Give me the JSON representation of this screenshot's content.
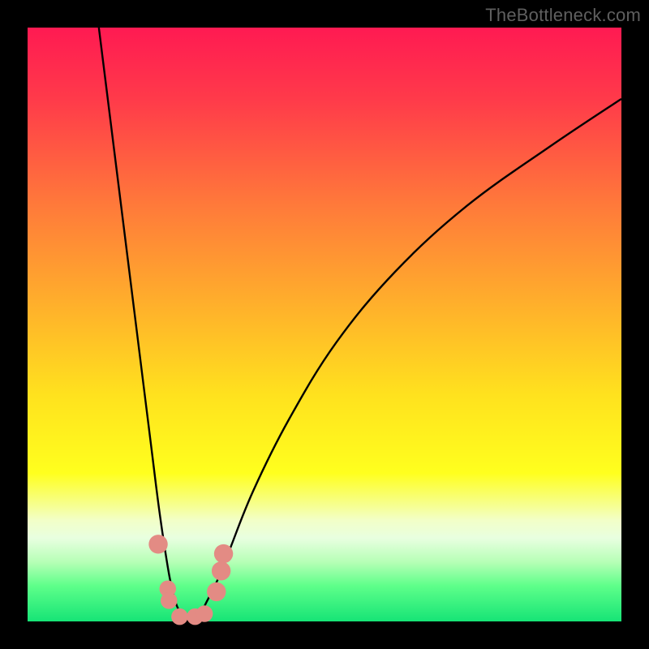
{
  "watermark": "TheBottleneck.com",
  "gradient": {
    "stops": [
      {
        "pct": 0,
        "color": "#ff1a52"
      },
      {
        "pct": 12,
        "color": "#ff3a4a"
      },
      {
        "pct": 30,
        "color": "#ff7a3a"
      },
      {
        "pct": 48,
        "color": "#ffb42a"
      },
      {
        "pct": 62,
        "color": "#ffe21e"
      },
      {
        "pct": 75,
        "color": "#ffff1e"
      },
      {
        "pct": 80,
        "color": "#f7ff87"
      },
      {
        "pct": 83,
        "color": "#f2ffc8"
      },
      {
        "pct": 86,
        "color": "#e8ffe0"
      },
      {
        "pct": 90,
        "color": "#b6ffb6"
      },
      {
        "pct": 94,
        "color": "#5eff8a"
      },
      {
        "pct": 100,
        "color": "#16e476"
      }
    ]
  },
  "chart_data": {
    "type": "line",
    "title": "",
    "xlabel": "",
    "ylabel": "",
    "xlim": [
      0,
      100
    ],
    "ylim": [
      0,
      100
    ],
    "series": [
      {
        "name": "bottleneck-curve",
        "x": [
          12,
          14,
          16,
          18,
          20,
          21,
          22,
          23,
          24,
          25,
          26,
          27,
          28,
          29,
          30,
          32,
          34,
          38,
          44,
          52,
          62,
          74,
          88,
          100
        ],
        "y": [
          100,
          84,
          68,
          52,
          36,
          28,
          20,
          13,
          7,
          3,
          1,
          0,
          0,
          1,
          3,
          7,
          12,
          22,
          34,
          47,
          59,
          70,
          80,
          88
        ]
      }
    ],
    "markers": [
      {
        "x": 22.0,
        "y": 13.0,
        "r": 1.6
      },
      {
        "x": 23.6,
        "y": 5.5,
        "r": 1.4
      },
      {
        "x": 23.8,
        "y": 3.5,
        "r": 1.4
      },
      {
        "x": 25.6,
        "y": 0.8,
        "r": 1.4
      },
      {
        "x": 28.2,
        "y": 0.8,
        "r": 1.4
      },
      {
        "x": 29.8,
        "y": 1.3,
        "r": 1.4
      },
      {
        "x": 31.8,
        "y": 5.0,
        "r": 1.6
      },
      {
        "x": 32.6,
        "y": 8.5,
        "r": 1.6
      },
      {
        "x": 33.0,
        "y": 11.4,
        "r": 1.6
      }
    ],
    "marker_color": "#e38b84",
    "curve_color": "#000000"
  }
}
